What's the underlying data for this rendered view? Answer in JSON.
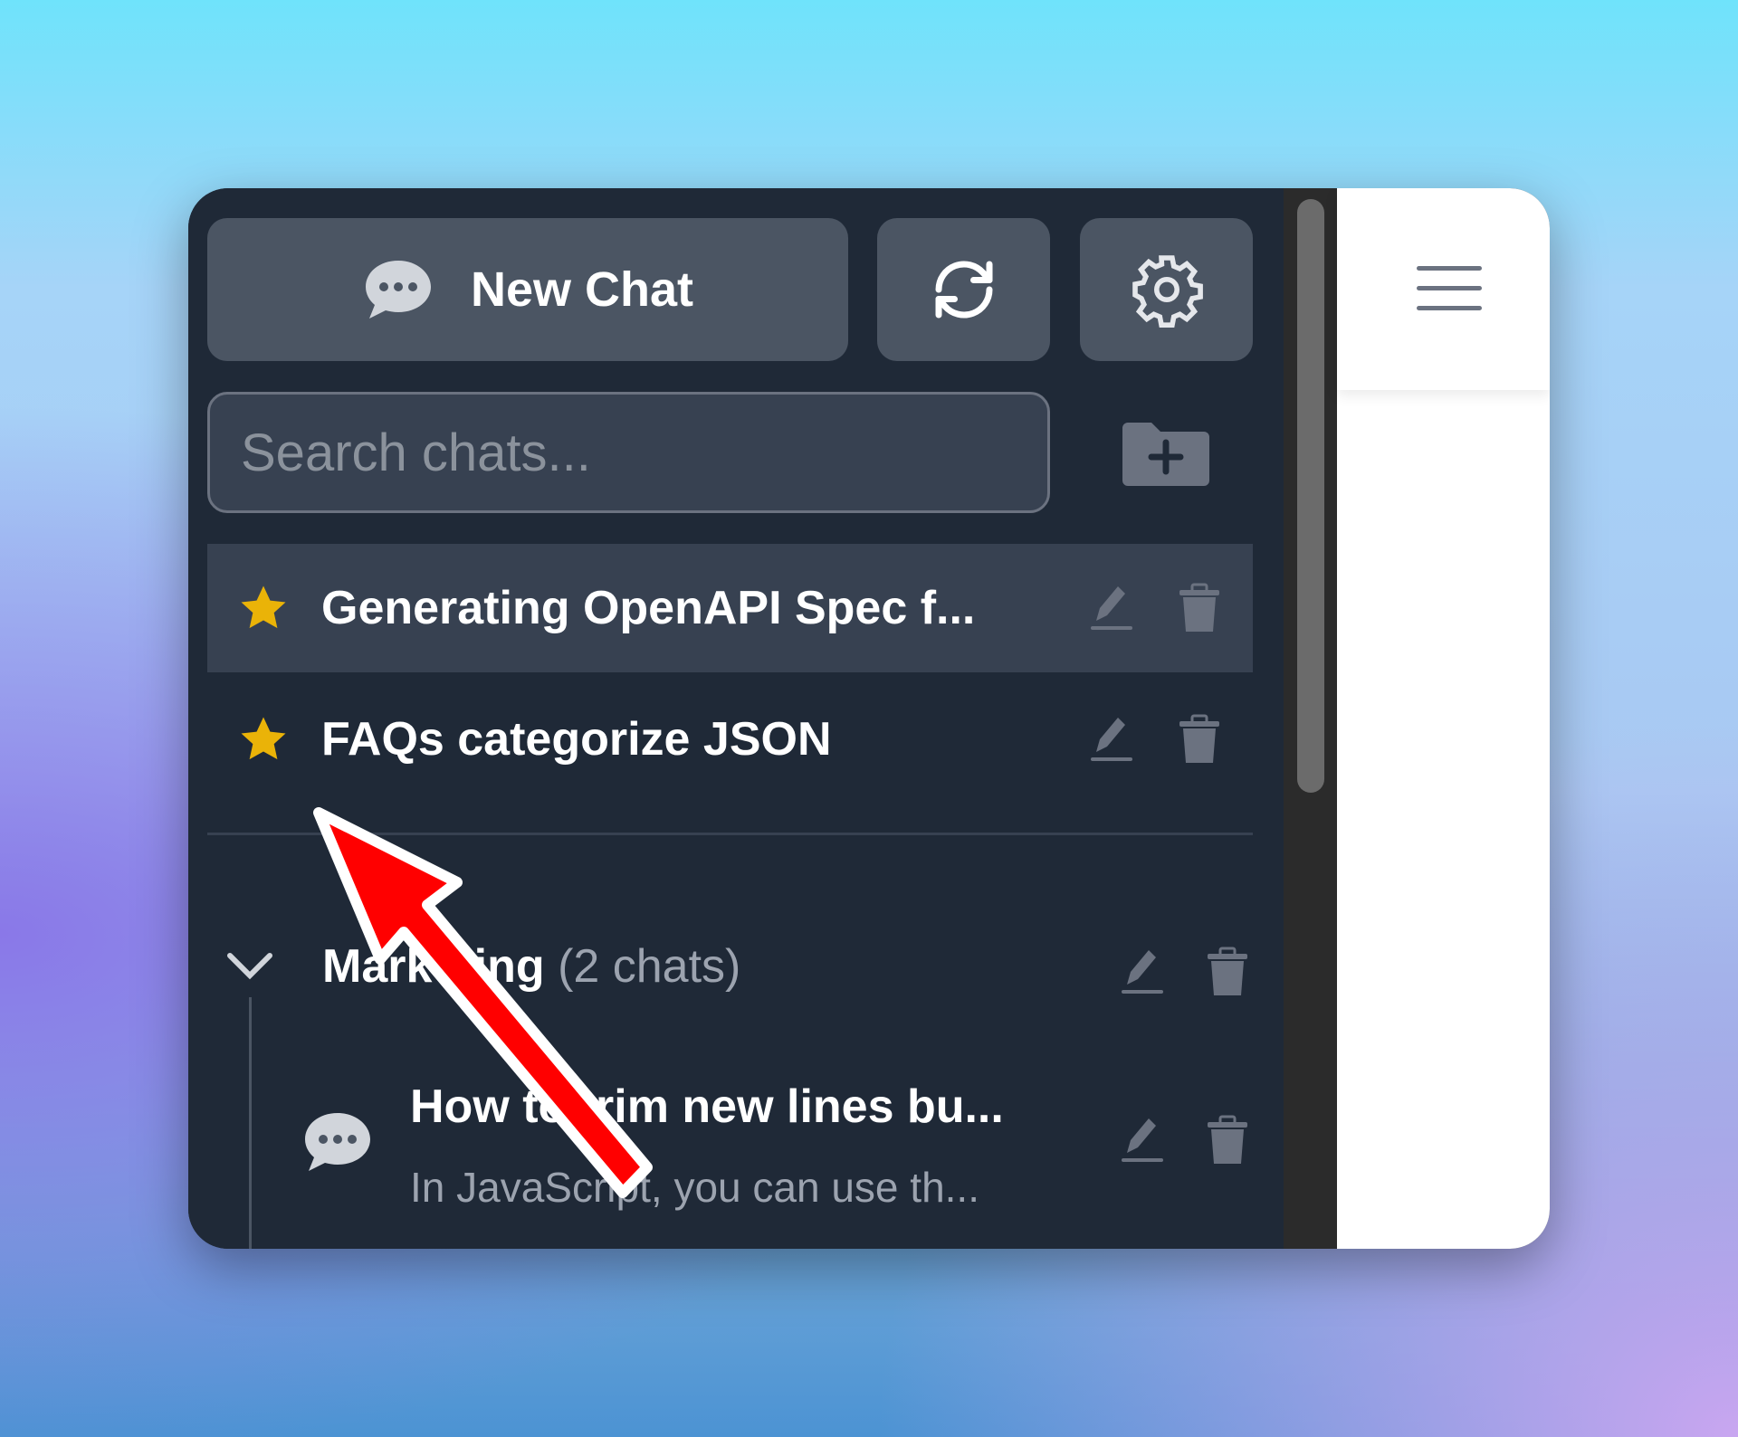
{
  "sidebar": {
    "new_chat_label": "New Chat",
    "search_placeholder": "Search chats...",
    "favorites": [
      {
        "title": "Generating OpenAPI Spec f...",
        "starred": true,
        "active": true
      },
      {
        "title": "FAQs categorize JSON",
        "starred": true,
        "active": false
      }
    ],
    "folder": {
      "name": "Marketing",
      "count": "(2 chats)",
      "expanded": true,
      "chats": [
        {
          "title": "How to trim new lines bu...",
          "preview": "In JavaScript, you can use th..."
        }
      ]
    }
  },
  "colors": {
    "sidebar": "#1f2937",
    "button": "#4b5563",
    "star": "#eab308",
    "annotation_arrow": "#ff0000"
  },
  "icons": [
    "chat-bubble-icon",
    "refresh-icon",
    "gear-icon",
    "folder-plus-icon",
    "star-icon",
    "pencil-icon",
    "trash-icon",
    "chevron-down-icon",
    "hamburger-menu-icon"
  ]
}
